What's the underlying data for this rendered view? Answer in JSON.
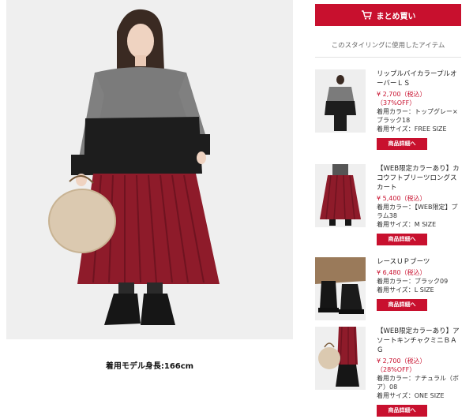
{
  "main": {
    "model_height": "着用モデル身長:166cm"
  },
  "sidebar": {
    "buy_button_label": "まとめ買い",
    "section_title": "このスタイリングに使用したアイテム",
    "products": [
      {
        "name": "リップルバイカラープルオーバーＬＳ",
        "price": "¥ 2,700（税込）",
        "discount": "（37%OFF）",
        "color": "着用カラー：トップグレー×ブラック18",
        "size": "着用サイズ：FREE SIZE",
        "detail_label": "商品詳細へ"
      },
      {
        "name": "【WEB限定カラーあり】カコウフトプリーツロングスカート",
        "price": "¥ 5,400（税込）",
        "discount": "",
        "color": "着用カラー：【WEB限定】プラム38",
        "size": "着用サイズ：M SIZE",
        "detail_label": "商品詳細へ"
      },
      {
        "name": "レースＵＰブーツ",
        "price": "¥ 6,480（税込）",
        "discount": "",
        "color": "着用カラー：ブラック09",
        "size": "着用サイズ：L SIZE",
        "detail_label": "商品詳細へ"
      },
      {
        "name": "【WEB限定カラーあり】アソートキンチャクミニＢＡＧ",
        "price": "¥ 2,700（税込）",
        "discount": "（28%OFF）",
        "color": "着用カラー：ナチュラル（ボア）08",
        "size": "着用サイズ：ONE SIZE",
        "detail_label": "商品詳細へ"
      }
    ]
  },
  "colors": {
    "accent": "#c8102e",
    "sweater_gray": "#7a7a7a",
    "sweater_black": "#1c1c1c",
    "skirt": "#8e1b2a"
  }
}
